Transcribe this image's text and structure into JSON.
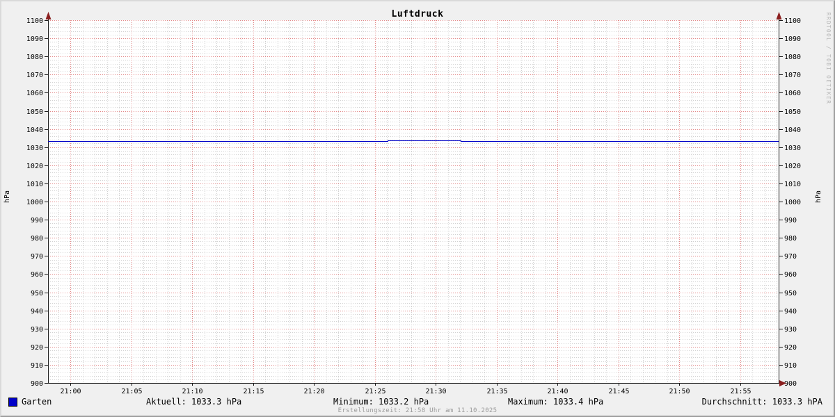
{
  "title": "Luftdruck",
  "watermark": "RRDTOOL / TOBI OETIKER",
  "y_axis_label_left": "hPa",
  "y_axis_label_right": "hPa",
  "legend": {
    "series_label": "Garten",
    "swatch_color": "#0000c8"
  },
  "stats": {
    "aktuell": "Aktuell: 1033.3 hPa",
    "minimum": "Minimum: 1033.2 hPa",
    "maximum": "Maximum: 1033.4 hPa",
    "durchschnitt": "Durchschnitt: 1033.3 hPA"
  },
  "footer": "Erstellungszeit: 21:58 Uhr am 11.10.2025",
  "colors": {
    "background": "#f0f0f0",
    "canvas": "#ffffff",
    "grid_minor": "#9a9a9a",
    "grid_major": "#dd6a6a",
    "axis": "#1a1a1a",
    "arrow": "#8b1f1f",
    "series": "#0000c8",
    "tick_text": "#000000"
  },
  "chart_data": {
    "type": "line",
    "title": "Luftdruck",
    "xlabel": "",
    "ylabel": "hPa",
    "ylim": [
      900,
      1100
    ],
    "y_major_step": 10,
    "y_minor_step": 2,
    "grid": true,
    "legend_position": "bottom",
    "x_span_minutes": 60,
    "x_minor_step_min": 1,
    "x_minor_first_offset_min": 0.83,
    "x_major_ticks": [
      {
        "label": "21:00",
        "offset_min": 1.83
      },
      {
        "label": "21:05",
        "offset_min": 6.83
      },
      {
        "label": "21:10",
        "offset_min": 11.83
      },
      {
        "label": "21:15",
        "offset_min": 16.83
      },
      {
        "label": "21:20",
        "offset_min": 21.83
      },
      {
        "label": "21:25",
        "offset_min": 26.83
      },
      {
        "label": "21:30",
        "offset_min": 31.83
      },
      {
        "label": "21:35",
        "offset_min": 36.83
      },
      {
        "label": "21:40",
        "offset_min": 41.83
      },
      {
        "label": "21:45",
        "offset_min": 46.83
      },
      {
        "label": "21:50",
        "offset_min": 51.83
      },
      {
        "label": "21:55",
        "offset_min": 56.83
      }
    ],
    "series": [
      {
        "name": "Garten",
        "color": "#0000c8",
        "points": [
          [
            0,
            1033.3
          ],
          [
            27.9,
            1033.3
          ],
          [
            27.9,
            1033.4
          ],
          [
            33.9,
            1033.4
          ],
          [
            33.9,
            1033.3
          ],
          [
            60,
            1033.3
          ]
        ]
      }
    ],
    "stats": {
      "aktuell_hpa": 1033.3,
      "minimum_hpa": 1033.2,
      "maximum_hpa": 1033.4,
      "durchschnitt_hpa": 1033.3
    }
  }
}
